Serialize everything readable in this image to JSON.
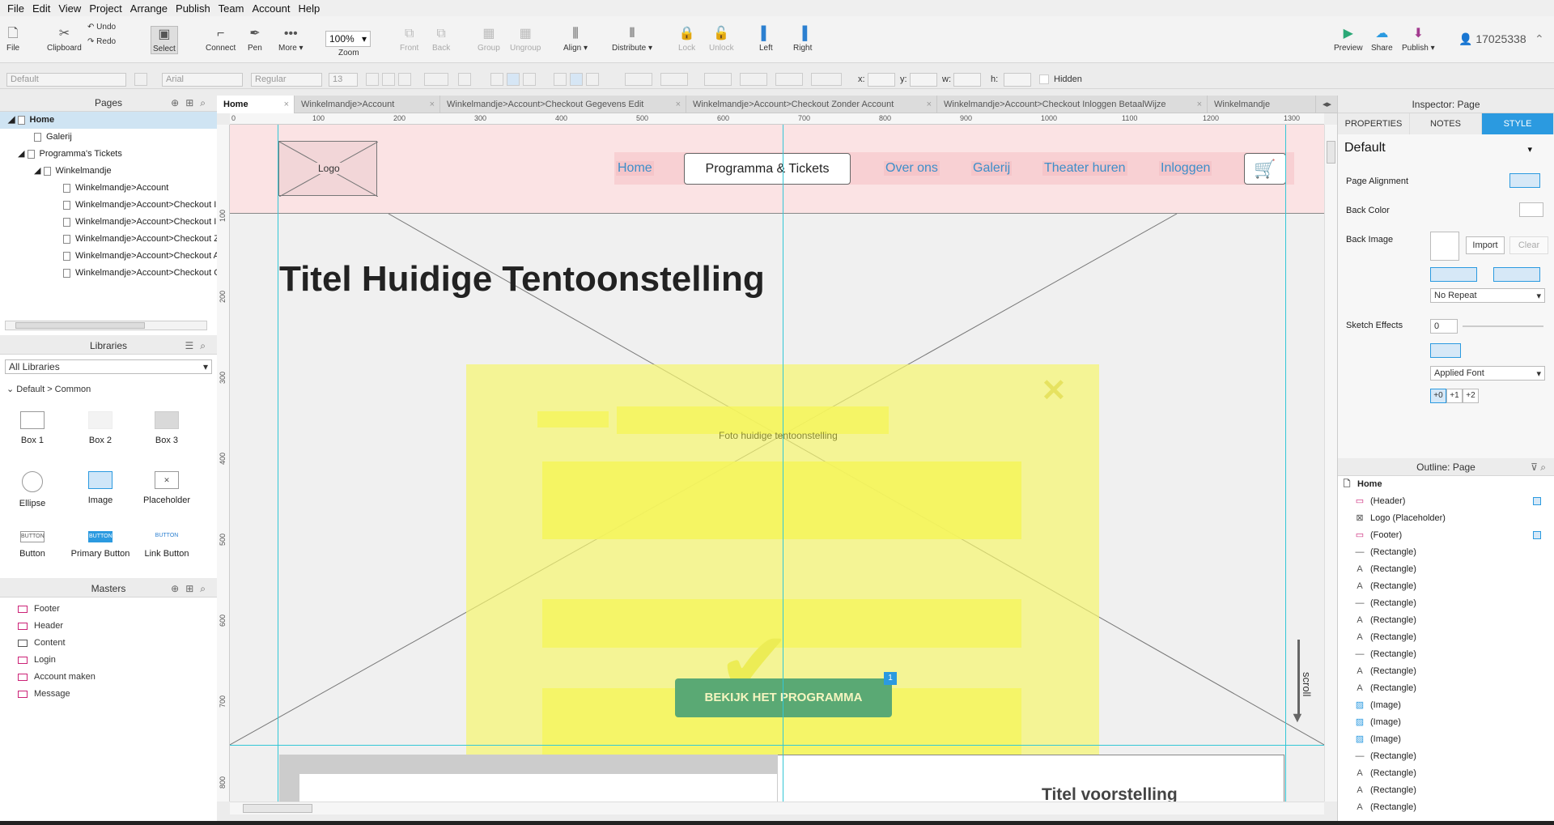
{
  "menu": [
    "File",
    "Edit",
    "View",
    "Project",
    "Arrange",
    "Publish",
    "Team",
    "Account",
    "Help"
  ],
  "toolbar": {
    "file": "File",
    "clipboard": "Clipboard",
    "undo": "Undo",
    "redo": "Redo",
    "select": "Select",
    "connect": "Connect",
    "pen": "Pen",
    "more": "More ▾",
    "zoom_value": "100%",
    "zoom": "Zoom",
    "front": "Front",
    "back": "Back",
    "group": "Group",
    "ungroup": "Ungroup",
    "align": "Align ▾",
    "distribute": "Distribute ▾",
    "lock": "Lock",
    "unlock": "Unlock",
    "left": "Left",
    "right": "Right",
    "preview": "Preview",
    "share": "Share",
    "publish": "Publish ▾",
    "user": "17025338"
  },
  "format": {
    "style": "Default",
    "font": "Arial",
    "weight": "Regular",
    "size": "13",
    "x": "x:",
    "y": "y:",
    "w": "w:",
    "h": "h:",
    "hidden": "Hidden"
  },
  "pages": {
    "title": "Pages",
    "items": [
      "Home",
      "Galerij",
      "Programma's Tickets",
      "Winkelmandje",
      "Winkelmandje>Account",
      "Winkelmandje>Account>Checkout In",
      "Winkelmandje>Account>Checkout In",
      "Winkelmandje>Account>Checkout Z",
      "Winkelmandje>Account>Checkout A",
      "Winkelmandje>Account>Checkout G"
    ]
  },
  "libraries": {
    "title": "Libraries",
    "select": "All Libraries",
    "group": "Default > Common",
    "items": [
      "Box 1",
      "Box 2",
      "Box 3",
      "Ellipse",
      "Image",
      "Placeholder",
      "Button",
      "Primary Button",
      "Link Button"
    ],
    "button_caption": "BUTTON"
  },
  "masters": {
    "title": "Masters",
    "items": [
      "Footer",
      "Header",
      "Content",
      "Login",
      "Account maken",
      "Message"
    ]
  },
  "tabs": [
    "Home",
    "Winkelmandje>Account",
    "Winkelmandje>Account>Checkout Gegevens Edit",
    "Winkelmandje>Account>Checkout Zonder Account",
    "Winkelmandje>Account>Checkout Inloggen BetaalWijze",
    "Winkelmandje"
  ],
  "ruler_top": [
    "0",
    "100",
    "200",
    "300",
    "400",
    "500",
    "600",
    "700",
    "800",
    "900",
    "1000",
    "1100",
    "1200",
    "1300"
  ],
  "ruler_left": [
    "100",
    "200",
    "300",
    "400",
    "500",
    "600",
    "700",
    "800"
  ],
  "canvas": {
    "logo": "Logo",
    "nav": [
      "Home",
      "Programma & Tickets",
      "Over ons",
      "Galerij",
      "Theater huren",
      "Inloggen"
    ],
    "title": "Titel Huidige Tentoonstelling",
    "photo_caption": "Foto huidige tentoonstelling",
    "cta": "BEKIJK HET PROGRAMMA",
    "cta_badge": "1",
    "scroll": "scroll",
    "show_title": "Titel voorstelling"
  },
  "inspector": {
    "title": "Inspector: Page",
    "tabs": [
      "PROPERTIES",
      "NOTES",
      "STYLE"
    ],
    "style": "Default",
    "page_alignment": "Page Alignment",
    "back_color": "Back Color",
    "back_image": "Back Image",
    "import": "Import",
    "clear": "Clear",
    "repeat": "No Repeat",
    "sketch": "Sketch Effects",
    "sketch_value": "0",
    "font": "Applied Font",
    "plus": [
      "+0",
      "+1",
      "+2"
    ]
  },
  "outline": {
    "title": "Outline: Page",
    "root": "Home",
    "items": [
      "(Header)",
      "Logo (Placeholder)",
      "(Footer)",
      "(Rectangle)",
      "(Rectangle)",
      "(Rectangle)",
      "(Rectangle)",
      "(Rectangle)",
      "(Rectangle)",
      "(Rectangle)",
      "(Rectangle)",
      "(Rectangle)",
      "(Image)",
      "(Image)",
      "(Image)",
      "(Rectangle)",
      "(Rectangle)",
      "(Rectangle)",
      "(Rectangle)"
    ],
    "icons": [
      "master",
      "placeholder",
      "master",
      "line",
      "text",
      "text",
      "line",
      "text",
      "text",
      "line",
      "text",
      "text",
      "image",
      "image",
      "image",
      "line",
      "text",
      "text",
      "text"
    ]
  },
  "colors": {
    "accent": "#2b9ae0",
    "header_bg": "#fbe3e4",
    "nav_text": "#3d8ec9",
    "highlight": "#f5f56e",
    "cta": "#5aa974"
  }
}
